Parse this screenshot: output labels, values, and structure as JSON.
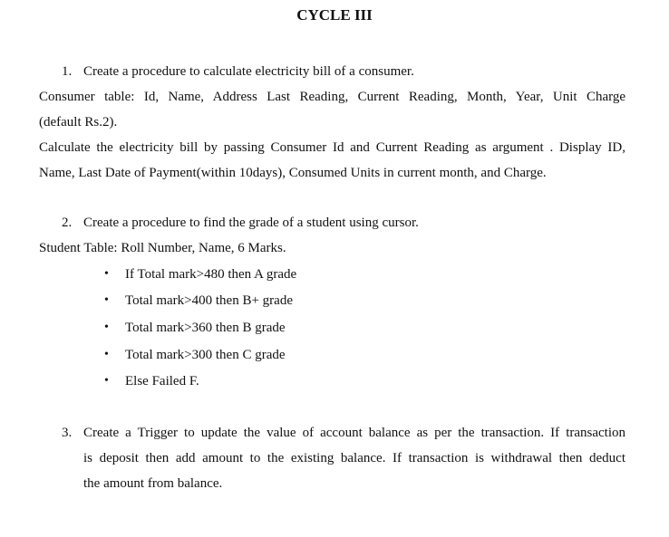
{
  "title": "CYCLE III",
  "item1": {
    "number": "1.",
    "heading": "Create a procedure to calculate electricity bill of a consumer.",
    "line1": "Consumer table: Id, Name, Address Last Reading, Current Reading, Month, Year, Unit Charge",
    "line2": "(default Rs.2).",
    "line3": "Calculate the electricity bill by passing Consumer Id and Current Reading as argument . Display ID,",
    "line4": "Name, Last Date of Payment(within 10days), Consumed Units in current month, and Charge."
  },
  "item2": {
    "number": "2.",
    "heading": "Create a procedure to find the grade of a student using cursor.",
    "table_line": "Student Table: Roll Number, Name, 6 Marks.",
    "bullet_glyph": "•",
    "bullets": [
      "If Total mark>480 then A grade",
      "Total mark>400 then B+ grade",
      "Total mark>360 then B grade",
      "Total mark>300 then C grade",
      "Else Failed F."
    ]
  },
  "item3": {
    "number": "3.",
    "line1": "Create a Trigger to update the value of account balance as per the transaction. If transaction",
    "line2": "is deposit then add amount to the existing balance. If transaction is withdrawal then deduct",
    "line3": "the amount from balance."
  }
}
